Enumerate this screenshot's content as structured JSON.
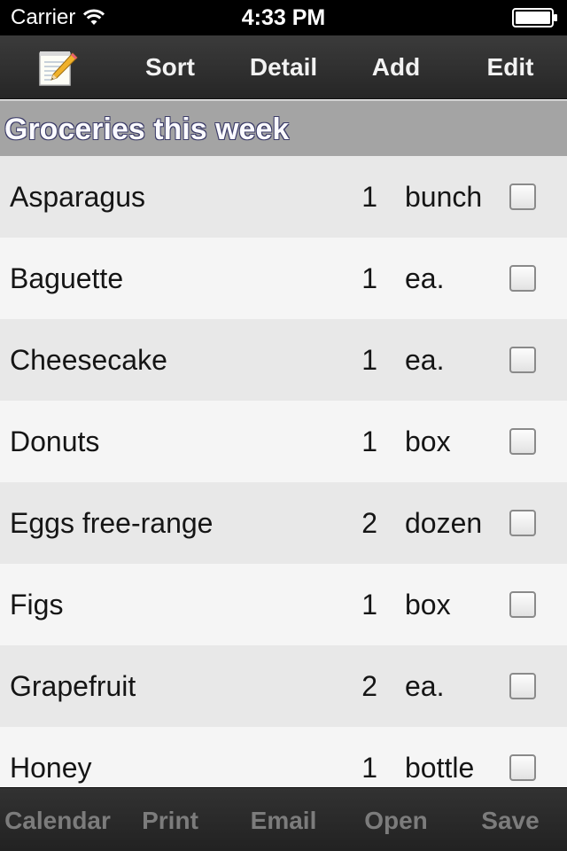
{
  "status_bar": {
    "carrier": "Carrier",
    "time": "4:33 PM",
    "icons": [
      "wifi-icon",
      "battery-icon"
    ]
  },
  "toolbar": {
    "icon": "notepad-pencil-icon",
    "sort_label": "Sort",
    "detail_label": "Detail",
    "add_label": "Add",
    "edit_label": "Edit"
  },
  "section": {
    "title": "Groceries this week"
  },
  "items": [
    {
      "name": "Asparagus",
      "qty": "1",
      "unit": "bunch",
      "checked": false
    },
    {
      "name": "Baguette",
      "qty": "1",
      "unit": "ea.",
      "checked": false
    },
    {
      "name": "Cheesecake",
      "qty": "1",
      "unit": "ea.",
      "checked": false
    },
    {
      "name": "Donuts",
      "qty": "1",
      "unit": "box",
      "checked": false
    },
    {
      "name": "Eggs free-range",
      "qty": "2",
      "unit": "dozen",
      "checked": false
    },
    {
      "name": "Figs",
      "qty": "1",
      "unit": "box",
      "checked": false
    },
    {
      "name": "Grapefruit",
      "qty": "2",
      "unit": "ea.",
      "checked": false
    },
    {
      "name": "Honey",
      "qty": "1",
      "unit": "bottle",
      "checked": false
    }
  ],
  "bottom_toolbar": {
    "calendar_label": "Calendar",
    "print_label": "Print",
    "email_label": "Email",
    "open_label": "Open",
    "save_label": "Save"
  },
  "colors": {
    "toolbar_bg": "#2f2f2f",
    "section_header_bg": "#a4a4a4",
    "row_shade": "#e8e8e8",
    "row_light": "#f5f5f5",
    "disabled_text": "#7c7c7c"
  }
}
